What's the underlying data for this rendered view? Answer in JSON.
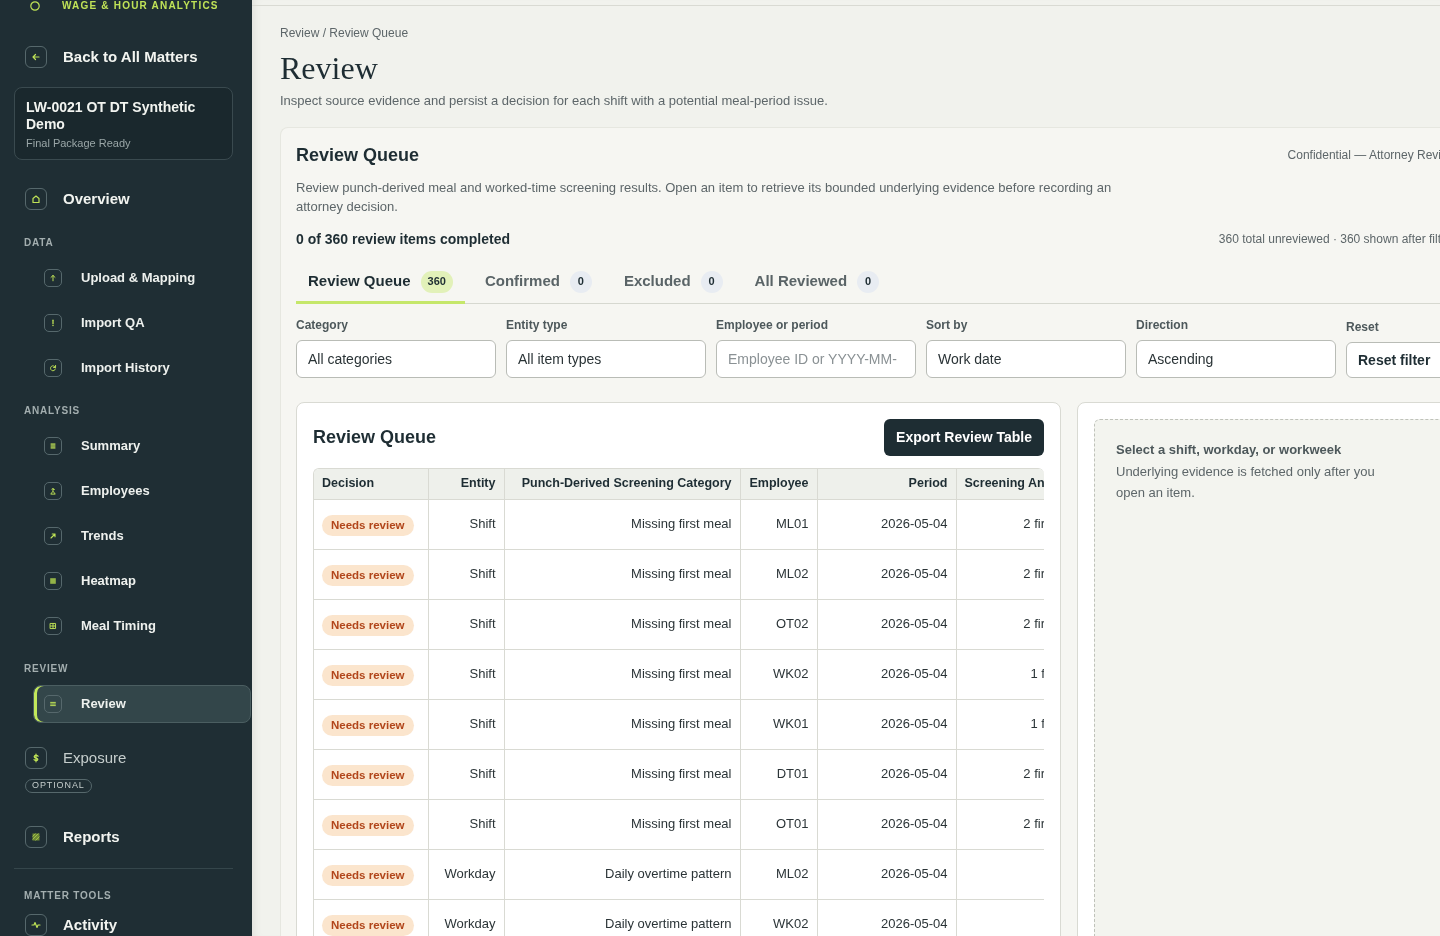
{
  "sidebar": {
    "brand": "WAGE & HOUR ANALYTICS",
    "back_link": "Back to All Matters",
    "matter": {
      "title": "LW-0021 OT DT Synthetic Demo",
      "status": "Final Package Ready"
    },
    "nav": [
      {
        "kind": "link",
        "label": "Overview",
        "selected": false
      },
      {
        "kind": "section",
        "label": "DATA",
        "children": [
          {
            "label": "Upload & Mapping",
            "selected": false
          },
          {
            "label": "Import QA",
            "selected": false
          },
          {
            "label": "Import History",
            "selected": false
          }
        ]
      },
      {
        "kind": "section",
        "label": "ANALYSIS",
        "children": [
          {
            "label": "Summary",
            "selected": false
          },
          {
            "label": "Employees",
            "selected": false
          },
          {
            "label": "Trends",
            "selected": false
          },
          {
            "label": "Heatmap",
            "selected": false
          },
          {
            "label": "Meal Timing",
            "selected": false
          }
        ]
      },
      {
        "kind": "section",
        "label": "REVIEW",
        "children": [
          {
            "label": "Review",
            "selected": true
          }
        ]
      },
      {
        "kind": "optional",
        "label": "Exposure",
        "badge": "OPTIONAL",
        "selected": false
      },
      {
        "kind": "link",
        "label": "Reports",
        "selected": false
      },
      {
        "kind": "tools",
        "label": "MATTER TOOLS",
        "children": [
          {
            "label": "Activity",
            "selected": false
          }
        ]
      }
    ]
  },
  "page": {
    "breadcrumb": "Review / Review Queue",
    "title": "Review",
    "description": "Inspect source evidence and persist a decision for each shift with a potential meal-period issue."
  },
  "queue": {
    "title": "Review Queue",
    "confidential": "Confidential — Attorney Revi",
    "intro": "Review punch-derived meal and worked-time screening results. Open an item to retrieve its bounded underlying evidence before recording an attorney decision.",
    "progress": "0 of 360 review items completed",
    "counts": "360 total unreviewed · 360 shown after filt",
    "tabs": [
      {
        "label": "Review Queue",
        "count": "360",
        "selected": true
      },
      {
        "label": "Confirmed",
        "count": "0",
        "selected": false
      },
      {
        "label": "Excluded",
        "count": "0",
        "selected": false
      },
      {
        "label": "All Reviewed",
        "count": "0",
        "selected": false
      }
    ],
    "filters": [
      {
        "kind": "select",
        "label": "Category",
        "value": "All categories"
      },
      {
        "kind": "select",
        "label": "Entity type",
        "value": "All item types"
      },
      {
        "kind": "text",
        "label": "Employee or period",
        "placeholder": "Employee ID or YYYY-MM-"
      },
      {
        "kind": "select",
        "label": "Sort by",
        "value": "Work date"
      },
      {
        "kind": "select",
        "label": "Direction",
        "value": "Ascending"
      },
      {
        "kind": "button",
        "label": "Reset",
        "value": "Reset filter"
      }
    ]
  },
  "table": {
    "title": "Review Queue",
    "export_button": "Export Review Table",
    "columns": [
      "Decision",
      "Entity",
      "Punch-Derived Screening Category",
      "Employee",
      "Period",
      "Screening An"
    ],
    "rows": [
      {
        "decision": "Needs review",
        "entity": "Shift",
        "category": "Missing first meal",
        "employee": "ML01",
        "period": "2026-05-04",
        "screening": "2 fir"
      },
      {
        "decision": "Needs review",
        "entity": "Shift",
        "category": "Missing first meal",
        "employee": "ML02",
        "period": "2026-05-04",
        "screening": "2 fir"
      },
      {
        "decision": "Needs review",
        "entity": "Shift",
        "category": "Missing first meal",
        "employee": "OT02",
        "period": "2026-05-04",
        "screening": "2 fir"
      },
      {
        "decision": "Needs review",
        "entity": "Shift",
        "category": "Missing first meal",
        "employee": "WK02",
        "period": "2026-05-04",
        "screening": "1 f"
      },
      {
        "decision": "Needs review",
        "entity": "Shift",
        "category": "Missing first meal",
        "employee": "WK01",
        "period": "2026-05-04",
        "screening": "1 f"
      },
      {
        "decision": "Needs review",
        "entity": "Shift",
        "category": "Missing first meal",
        "employee": "DT01",
        "period": "2026-05-04",
        "screening": "2 fir"
      },
      {
        "decision": "Needs review",
        "entity": "Shift",
        "category": "Missing first meal",
        "employee": "OT01",
        "period": "2026-05-04",
        "screening": "2 fir"
      },
      {
        "decision": "Needs review",
        "entity": "Workday",
        "category": "Daily overtime pattern",
        "employee": "ML02",
        "period": "2026-05-04"
      },
      {
        "decision": "Needs review",
        "entity": "Workday",
        "category": "Daily overtime pattern",
        "employee": "WK02",
        "period": "2026-05-04"
      }
    ]
  },
  "evidence_panel": {
    "title": "Select a shift, workday, or workweek",
    "text": "Underlying evidence is fetched only after you open an item."
  }
}
